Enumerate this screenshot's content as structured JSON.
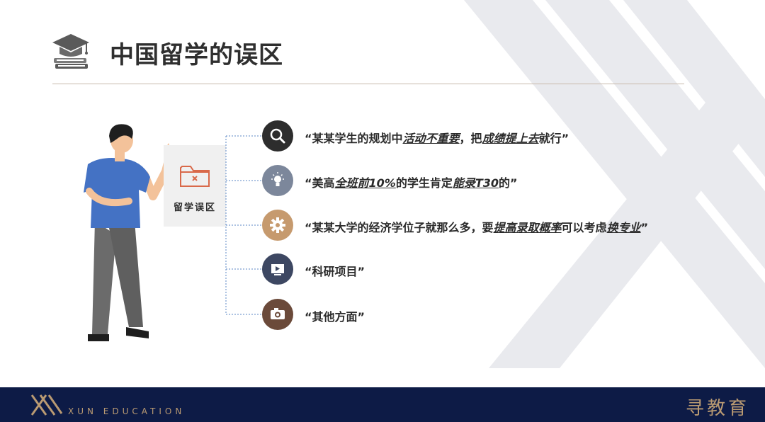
{
  "slide": {
    "title": "中国留学的误区",
    "label_card_text": "留学误区"
  },
  "items": [
    {
      "icon": "search-icon",
      "color": "#2d2d2d",
      "segments": [
        {
          "t": "“某某学生的规划中",
          "em": false
        },
        {
          "t": "活动不重要",
          "em": true
        },
        {
          "t": "，把",
          "em": false
        },
        {
          "t": "成绩提上去",
          "em": true
        },
        {
          "t": "就行”",
          "em": false
        }
      ]
    },
    {
      "icon": "lightbulb-icon",
      "color": "#7c879b",
      "segments": [
        {
          "t": "“美高",
          "em": false
        },
        {
          "t": "全班前10%",
          "em": true
        },
        {
          "t": "的学生肯定",
          "em": false
        },
        {
          "t": "能录T30",
          "em": true
        },
        {
          "t": "的”",
          "em": false
        }
      ]
    },
    {
      "icon": "gear-icon",
      "color": "#c69a6e",
      "segments": [
        {
          "t": "“某某大学的经济学位子就那么多，要",
          "em": false
        },
        {
          "t": "提高录取概率",
          "em": true
        },
        {
          "t": "可以考虑",
          "em": false
        },
        {
          "t": "换专业",
          "em": true
        },
        {
          "t": "”",
          "em": false
        }
      ]
    },
    {
      "icon": "video-icon",
      "color": "#3d4762",
      "segments": [
        {
          "t": "“科研项目”",
          "em": false
        }
      ]
    },
    {
      "icon": "camera-icon",
      "color": "#6b4a3a",
      "segments": [
        {
          "t": "“其他方面”",
          "em": false
        }
      ]
    }
  ],
  "footer": {
    "brand_en": "XUN EDUCATION",
    "brand_cn": "寻教育",
    "background": "#0d1b46",
    "accent": "#b99a72"
  }
}
